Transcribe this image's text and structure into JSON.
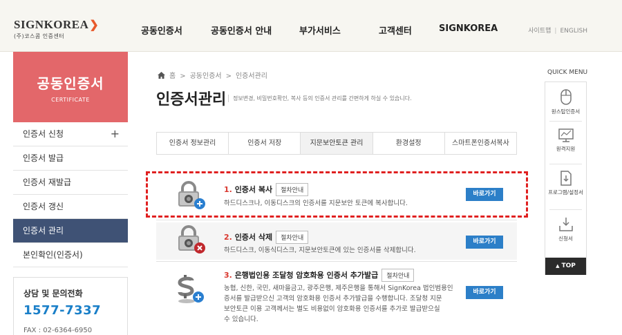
{
  "header": {
    "logo": {
      "main": "SIGNKOREA",
      "sub": "(주)코스콤 인증센터"
    },
    "nav": [
      "공동인증서",
      "공동인증서 안내",
      "부가서비스",
      "고객센터",
      "SIGNKOREA"
    ],
    "util": {
      "sitemap": "사이트맵",
      "english": "ENGLISH"
    }
  },
  "sidebar": {
    "title": "공동인증서",
    "subtitle": "CERTIFICATE",
    "items": [
      {
        "label": "인증서 신청",
        "plus": "+"
      },
      {
        "label": "인증서 발급"
      },
      {
        "label": "인증서 재발급"
      },
      {
        "label": "인증서 갱신"
      },
      {
        "label": "인증서 관리"
      },
      {
        "label": "본인확인(인증서)"
      }
    ],
    "contact": {
      "label": "상담 및 문의전화",
      "tel": "1577-7337",
      "fax": "FAX : 02-6364-6950"
    }
  },
  "breadcrumb": {
    "home": "홈",
    "level1": "공동인증서",
    "level2": "인증서관리",
    "sep": ">"
  },
  "page": {
    "title": "인증서관리",
    "desc": "정보변경, 비밀번호확인, 복사 등의 인증서 관리를 간편하게 하실 수 있습니다."
  },
  "tabs": [
    "인증서 정보관리",
    "인증서 저장",
    "지문보안토큰 관리",
    "환경설정",
    "스마트폰인증서복사"
  ],
  "items": [
    {
      "num": "1.",
      "title": "인증서 복사",
      "proc": "절차안내",
      "desc": [
        "하드디스크나, 이동디스크의 인증서를 지문보안 토큰에 복사합니다."
      ],
      "go": "바로가기"
    },
    {
      "num": "2.",
      "title": "인증서 삭제",
      "proc": "절차안내",
      "desc": [
        "하드디스크, 이동식디스크, 지문보안토큰에 있는 인증서를 삭제합니다."
      ],
      "go": "바로가기"
    },
    {
      "num": "3.",
      "title": "은행법인용 조달청 암호화용 인증서 추가발급",
      "proc": "절차안내",
      "desc": [
        "농협, 신한, 국민, 새마을금고, 광주은행, 제주은행을 통해서 SignKorea 법인범용인",
        "증서를 발급받으신 고객의 암호화용 인증서 추가발급을 수행합니다. 조달청 지문",
        "보안토큰 이용 고객께서는 별도 비용없이 암호화용 인증서를 추가로 발급받으실",
        "수 있습니다."
      ],
      "go": "바로가기"
    }
  ],
  "quick_menu": {
    "label": "QUICK MENU",
    "items": [
      {
        "label": "원스탑인증서"
      },
      {
        "label": "원격지원"
      },
      {
        "label": "프로그램/설정서"
      },
      {
        "label": "신청서"
      }
    ],
    "top": "TOP"
  },
  "colors": {
    "accent_red": "#e3676a",
    "active_nav": "#3f5275",
    "button_blue": "#2c7fc8",
    "number_red": "#d9372e"
  }
}
